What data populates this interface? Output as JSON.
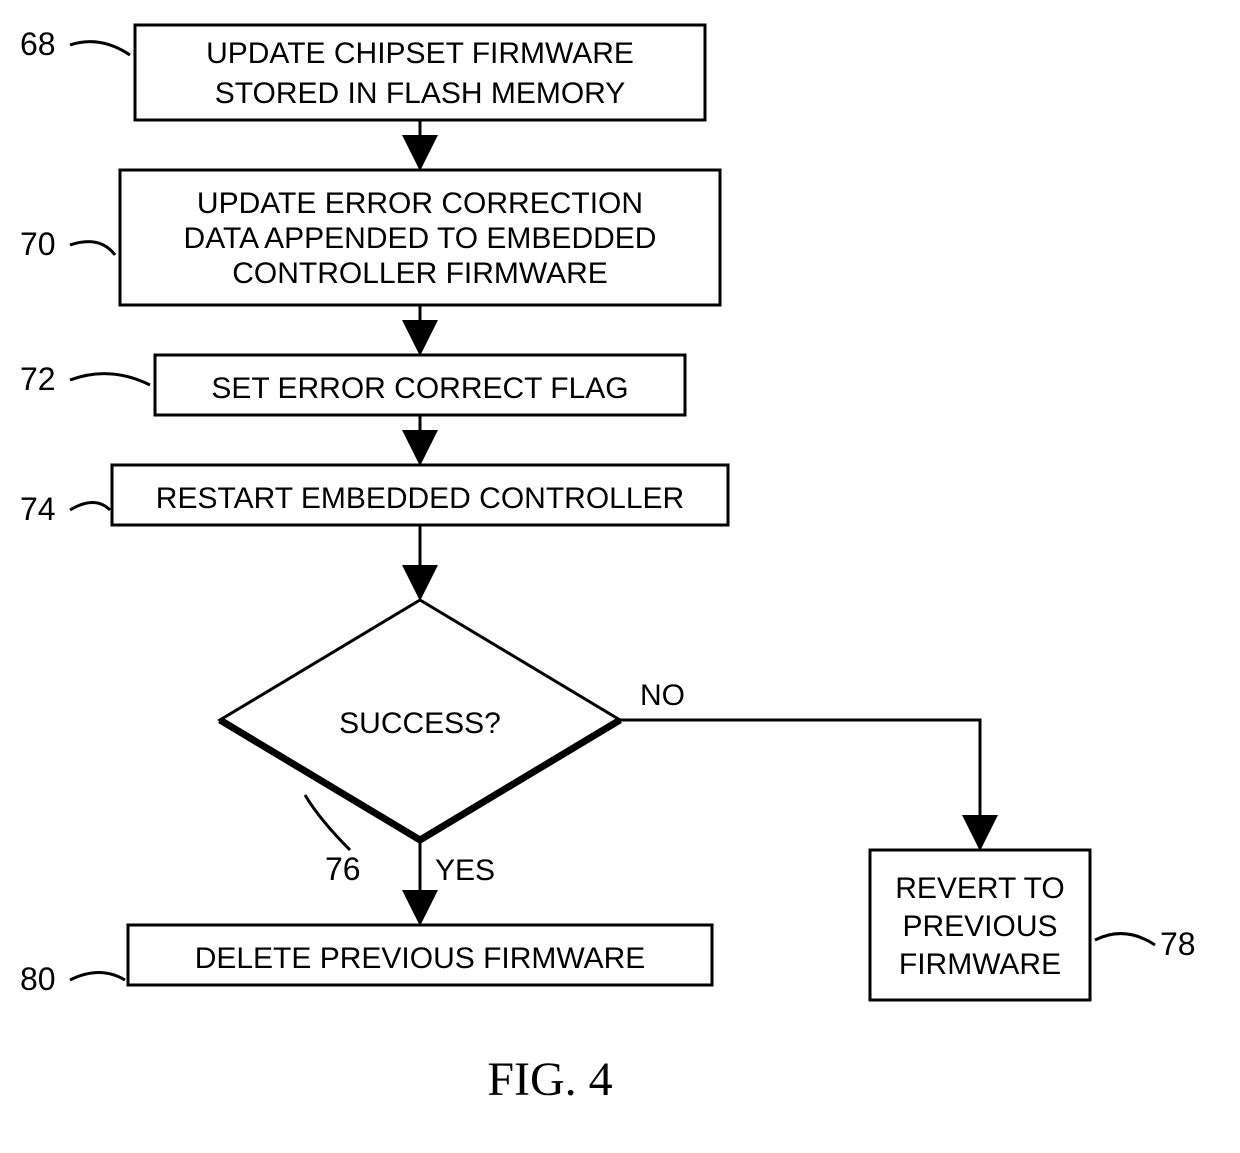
{
  "chart_data": {
    "type": "flowchart",
    "nodes": [
      {
        "id": "68",
        "kind": "process",
        "label": "UPDATE CHIPSET FIRMWARE STORED IN FLASH MEMORY"
      },
      {
        "id": "70",
        "kind": "process",
        "label": "UPDATE ERROR CORRECTION DATA APPENDED TO EMBEDDED CONTROLLER FIRMWARE"
      },
      {
        "id": "72",
        "kind": "process",
        "label": "SET ERROR CORRECT FLAG"
      },
      {
        "id": "74",
        "kind": "process",
        "label": "RESTART EMBEDDED CONTROLLER"
      },
      {
        "id": "76",
        "kind": "decision",
        "label": "SUCCESS?"
      },
      {
        "id": "78",
        "kind": "process",
        "label": "REVERT TO PREVIOUS FIRMWARE"
      },
      {
        "id": "80",
        "kind": "process",
        "label": "DELETE PREVIOUS FIRMWARE"
      }
    ],
    "edges": [
      {
        "from": "68",
        "to": "70"
      },
      {
        "from": "70",
        "to": "72"
      },
      {
        "from": "72",
        "to": "74"
      },
      {
        "from": "74",
        "to": "76"
      },
      {
        "from": "76",
        "to": "80",
        "label": "YES"
      },
      {
        "from": "76",
        "to": "78",
        "label": "NO"
      }
    ],
    "title": "FIG. 4"
  },
  "figure_label": "FIG. 4",
  "refs": {
    "n68": "68",
    "n70": "70",
    "n72": "72",
    "n74": "74",
    "n76": "76",
    "n78": "78",
    "n80": "80"
  },
  "branches": {
    "yes": "YES",
    "no": "NO"
  },
  "boxes": {
    "b68_l1": "UPDATE CHIPSET FIRMWARE",
    "b68_l2": "STORED IN FLASH MEMORY",
    "b70_l1": "UPDATE ERROR CORRECTION",
    "b70_l2": "DATA APPENDED TO EMBEDDED",
    "b70_l3": "CONTROLLER FIRMWARE",
    "b72_l1": "SET ERROR CORRECT FLAG",
    "b74_l1": "RESTART EMBEDDED CONTROLLER",
    "b76_l1": "SUCCESS?",
    "b78_l1": "REVERT TO",
    "b78_l2": "PREVIOUS",
    "b78_l3": "FIRMWARE",
    "b80_l1": "DELETE PREVIOUS FIRMWARE"
  }
}
